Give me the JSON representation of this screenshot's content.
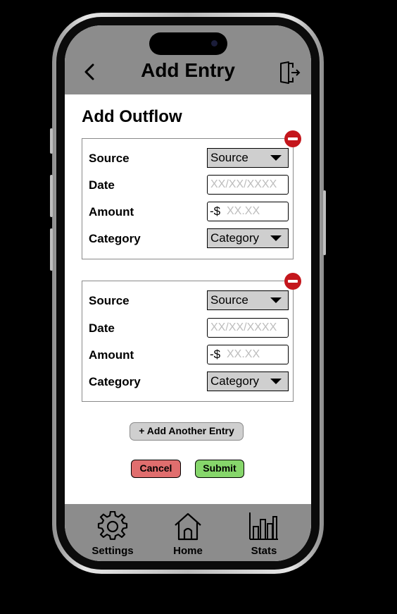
{
  "header": {
    "title": "Add Entry",
    "back_icon": "chevron-left-icon",
    "logout_icon": "logout-door-icon"
  },
  "section_title": "Add Outflow",
  "entries": [
    {
      "source_label": "Source",
      "source_value": "Source",
      "date_label": "Date",
      "date_placeholder": "XX/XX/XXXX",
      "amount_label": "Amount",
      "amount_prefix": "-$",
      "amount_placeholder": "XX.XX",
      "category_label": "Category",
      "category_value": "Category"
    },
    {
      "source_label": "Source",
      "source_value": "Source",
      "date_label": "Date",
      "date_placeholder": "XX/XX/XXXX",
      "amount_label": "Amount",
      "amount_prefix": "-$",
      "amount_placeholder": "XX.XX",
      "category_label": "Category",
      "category_value": "Category"
    }
  ],
  "actions": {
    "add_another": "+ Add Another Entry",
    "cancel": "Cancel",
    "submit": "Submit"
  },
  "tabs": [
    {
      "label": "Settings",
      "icon": "gear-icon"
    },
    {
      "label": "Home",
      "icon": "house-icon"
    },
    {
      "label": "Stats",
      "icon": "bar-chart-icon"
    }
  ],
  "colors": {
    "bars": "#8c8c8c",
    "remove": "#c4161c",
    "cancel": "#e06e6e",
    "submit": "#86d66b",
    "dropdown": "#cfcfcf"
  }
}
